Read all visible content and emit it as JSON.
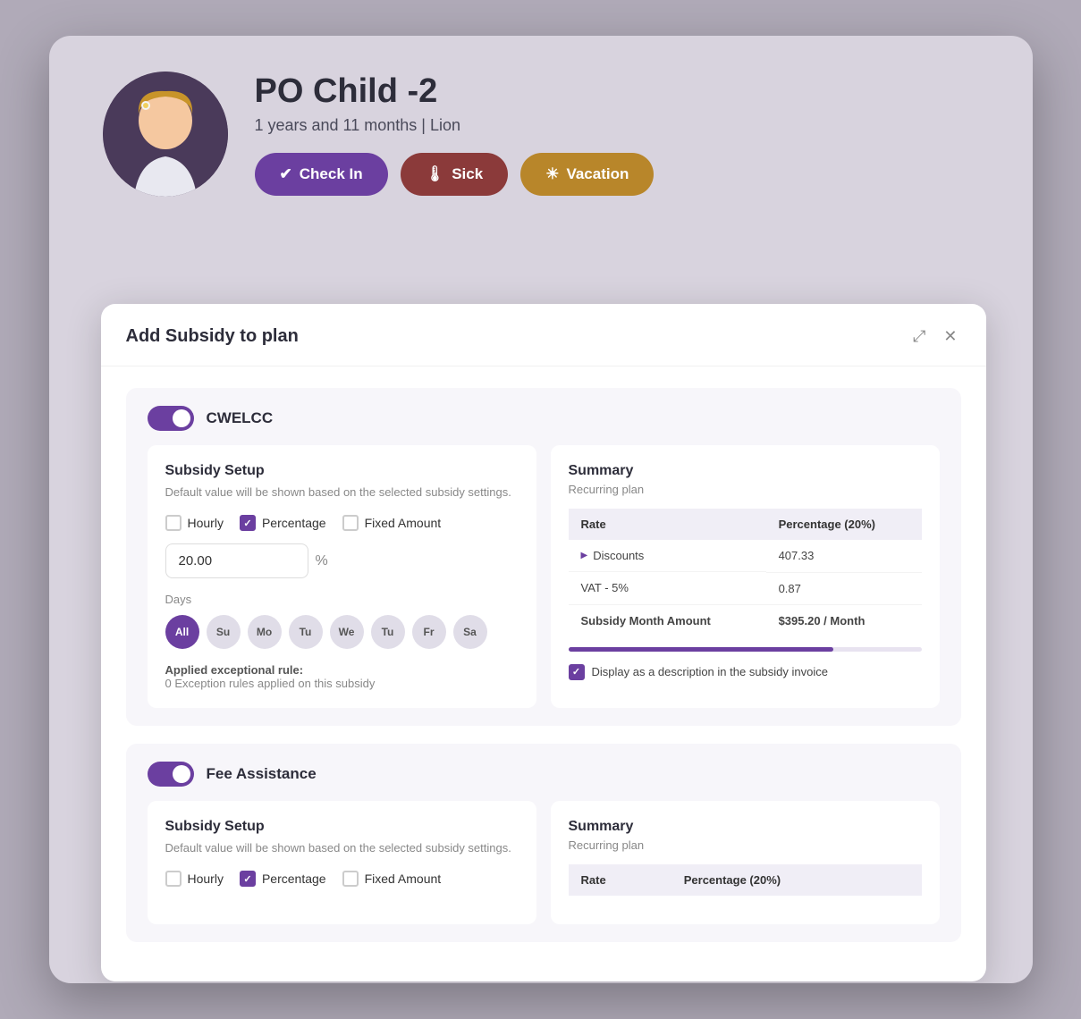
{
  "header": {
    "child_name": "PO Child -2",
    "child_meta": "1 years and 11 months | Lion",
    "btn_checkin": "Check In",
    "btn_sick": "Sick",
    "btn_vacation": "Vacation"
  },
  "modal": {
    "title": "Add Subsidy to plan",
    "section1": {
      "toggle_label": "CWELCC",
      "subsidy_setup": {
        "title": "Subsidy Setup",
        "description": "Default value will be shown based on the selected subsidy settings.",
        "checkboxes": [
          {
            "label": "Hourly",
            "checked": false
          },
          {
            "label": "Percentage",
            "checked": true
          },
          {
            "label": "Fixed Amount",
            "checked": false
          }
        ],
        "value": "20.00",
        "unit": "%",
        "days_label": "Days",
        "days": [
          {
            "label": "All",
            "active": true
          },
          {
            "label": "Su",
            "active": false
          },
          {
            "label": "Mo",
            "active": false
          },
          {
            "label": "Tu",
            "active": false
          },
          {
            "label": "We",
            "active": false
          },
          {
            "label": "Tu",
            "active": false
          },
          {
            "label": "Fr",
            "active": false
          },
          {
            "label": "Sa",
            "active": false
          }
        ],
        "exception_title": "Applied exceptional rule:",
        "exception_desc": "0 Exception rules applied on this subsidy"
      },
      "summary": {
        "title": "Summary",
        "subtitle": "Recurring plan",
        "rate_header": "Rate",
        "rate_value": "Percentage (20%)",
        "rows": [
          {
            "label": "Discounts",
            "value": "407.33",
            "has_triangle": true,
            "bold": false
          },
          {
            "label": "VAT - 5%",
            "value": "0.87",
            "has_triangle": false,
            "bold": false
          },
          {
            "label": "Subsidy Month Amount",
            "value": "$395.20 / Month",
            "has_triangle": false,
            "bold": true
          }
        ],
        "display_checkbox": true,
        "display_label": "Display as a description in the subsidy invoice"
      }
    },
    "section2": {
      "toggle_label": "Fee Assistance",
      "subsidy_setup": {
        "title": "Subsidy Setup",
        "description": "Default value will be shown based on the selected subsidy settings.",
        "checkboxes": [
          {
            "label": "Hourly",
            "checked": false
          },
          {
            "label": "Percentage",
            "checked": true
          },
          {
            "label": "Fixed Amount",
            "checked": false
          }
        ]
      },
      "summary": {
        "title": "Summary",
        "subtitle": "Recurring plan",
        "rate_header": "Rate",
        "rate_value": "Percentage (20%)"
      }
    }
  }
}
